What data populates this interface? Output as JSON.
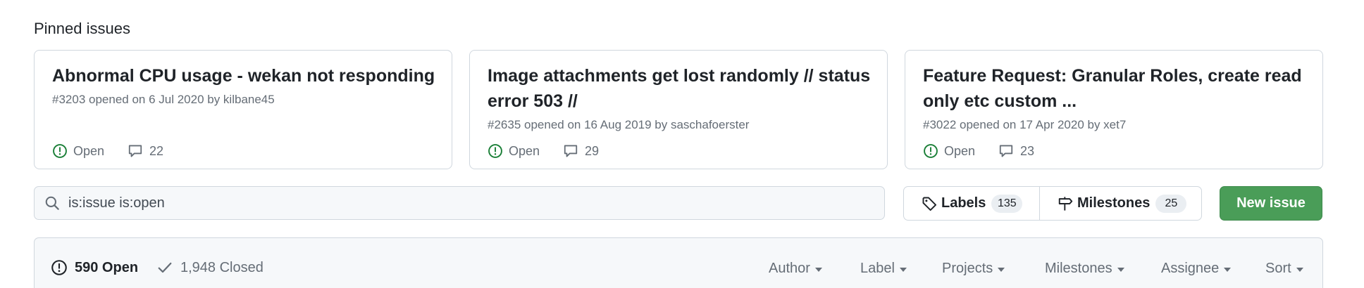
{
  "pinned": {
    "heading": "Pinned issues",
    "cards": [
      {
        "title": "Abnormal CPU usage - wekan not responding",
        "meta": "#3203 opened on 6 Jul 2020 by kilbane45",
        "status": "Open",
        "comments": "22"
      },
      {
        "title": "Image attachments get lost randomly // status error 503 //",
        "meta": "#2635 opened on 16 Aug 2019 by saschafoerster",
        "status": "Open",
        "comments": "29"
      },
      {
        "title": "Feature Request: Granular Roles, create read only etc custom ...",
        "meta": "#3022 opened on 17 Apr 2020 by xet7",
        "status": "Open",
        "comments": "23"
      }
    ]
  },
  "search": {
    "value": "is:issue is:open"
  },
  "toolbar": {
    "labels": {
      "label": "Labels",
      "count": "135"
    },
    "milestones": {
      "label": "Milestones",
      "count": "25"
    },
    "new_issue": "New issue"
  },
  "list_header": {
    "open": "590 Open",
    "closed": "1,948 Closed",
    "filters": [
      "Author",
      "Label",
      "Projects",
      "Milestones",
      "Assignee",
      "Sort"
    ]
  },
  "colors": {
    "open_green": "#1a7f37",
    "button_green": "#4a9d58",
    "muted": "#656d76",
    "border": "#d0d7de"
  }
}
